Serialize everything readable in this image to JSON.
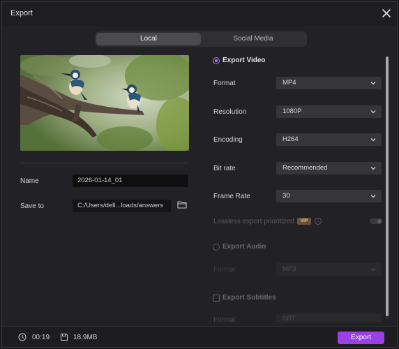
{
  "window": {
    "title": "Export"
  },
  "tabs": [
    {
      "label": "Local",
      "active": true
    },
    {
      "label": "Social Media",
      "active": false
    }
  ],
  "left": {
    "name_label": "Name",
    "name_value": "2026-01-14_01",
    "save_label": "Save to",
    "save_path": "C:/Users/dell...loads/answers"
  },
  "right": {
    "export_video": {
      "label": "Export Video",
      "checked": true
    },
    "format": {
      "label": "Format",
      "value": "MP4"
    },
    "resolution": {
      "label": "Resolution",
      "value": "1080P"
    },
    "encoding": {
      "label": "Encoding",
      "value": "H264"
    },
    "bitrate": {
      "label": "Bit rate",
      "value": "Recommended"
    },
    "framerate": {
      "label": "Frame Rate",
      "value": "30"
    },
    "lossless": {
      "label": "Lossless export prioritized",
      "badge": "VIP",
      "info": "i",
      "enabled": false
    },
    "export_audio": {
      "label": "Export Audio",
      "checked": false,
      "format_label": "Format",
      "format_value": "MP3"
    },
    "export_subtitles": {
      "label": "Export Subtitles",
      "checked": false,
      "format_label": "Format",
      "format_value": "SRT"
    }
  },
  "footer": {
    "duration": "00:19",
    "size": "18.9MB",
    "export_label": "Export"
  },
  "colors": {
    "accent": "#9b3fe6",
    "radio_on": "#c06dff",
    "background": "#222226"
  }
}
